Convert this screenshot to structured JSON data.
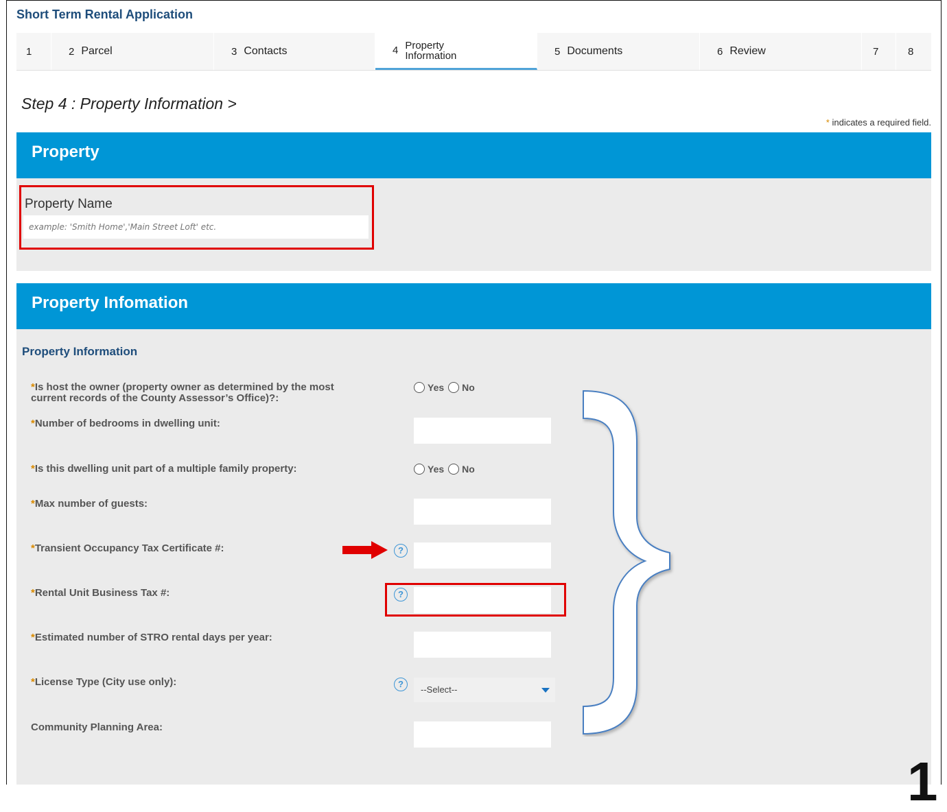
{
  "app_title": "Short Term Rental Application",
  "steps": [
    {
      "num": "1",
      "label": ""
    },
    {
      "num": "2",
      "label": "Parcel"
    },
    {
      "num": "3",
      "label": "Contacts"
    },
    {
      "num": "4",
      "label_line1": "Property",
      "label_line2": "Information",
      "active": true
    },
    {
      "num": "5",
      "label": "Documents"
    },
    {
      "num": "6",
      "label": "Review"
    },
    {
      "num": "7",
      "label": ""
    },
    {
      "num": "8",
      "label": ""
    }
  ],
  "step_heading": "Step 4 : Property Information >",
  "required_note": {
    "star": "*",
    "text": "indicates a required field."
  },
  "property_section": {
    "title": "Property",
    "property_name_label": "Property Name",
    "property_name_placeholder": "example: 'Smith Home','Main Street Loft' etc."
  },
  "info_section": {
    "title": "Property Infomation",
    "subtitle": "Property Information",
    "questions": {
      "q1_line1": "Is host the owner (property owner as determined by the most",
      "q1_line2": "current records of the County Assessor’s Office)?:",
      "q2": "Number of bedrooms in dwelling unit:",
      "q3": "Is this dwelling unit part of a multiple family property:",
      "q4": "Max number of guests:",
      "q5": "Transient Occupancy Tax Certificate #:",
      "q6": "Rental Unit Business Tax #:",
      "q7": "Estimated number of STRO rental days per year:",
      "q8": "License Type (City use only):",
      "q9": "Community Planning Area:"
    },
    "radio_yes": "Yes",
    "radio_no": "No",
    "required_star": "*",
    "help_glyph": "?",
    "select_value": "--Select--"
  },
  "annotation_number": "1",
  "colors": {
    "section_bar": "#0096d6",
    "title_blue": "#1e4d7b",
    "required_star": "#d98a00",
    "annotation_red": "#e00000",
    "brace_outline": "#4a7fc1"
  }
}
